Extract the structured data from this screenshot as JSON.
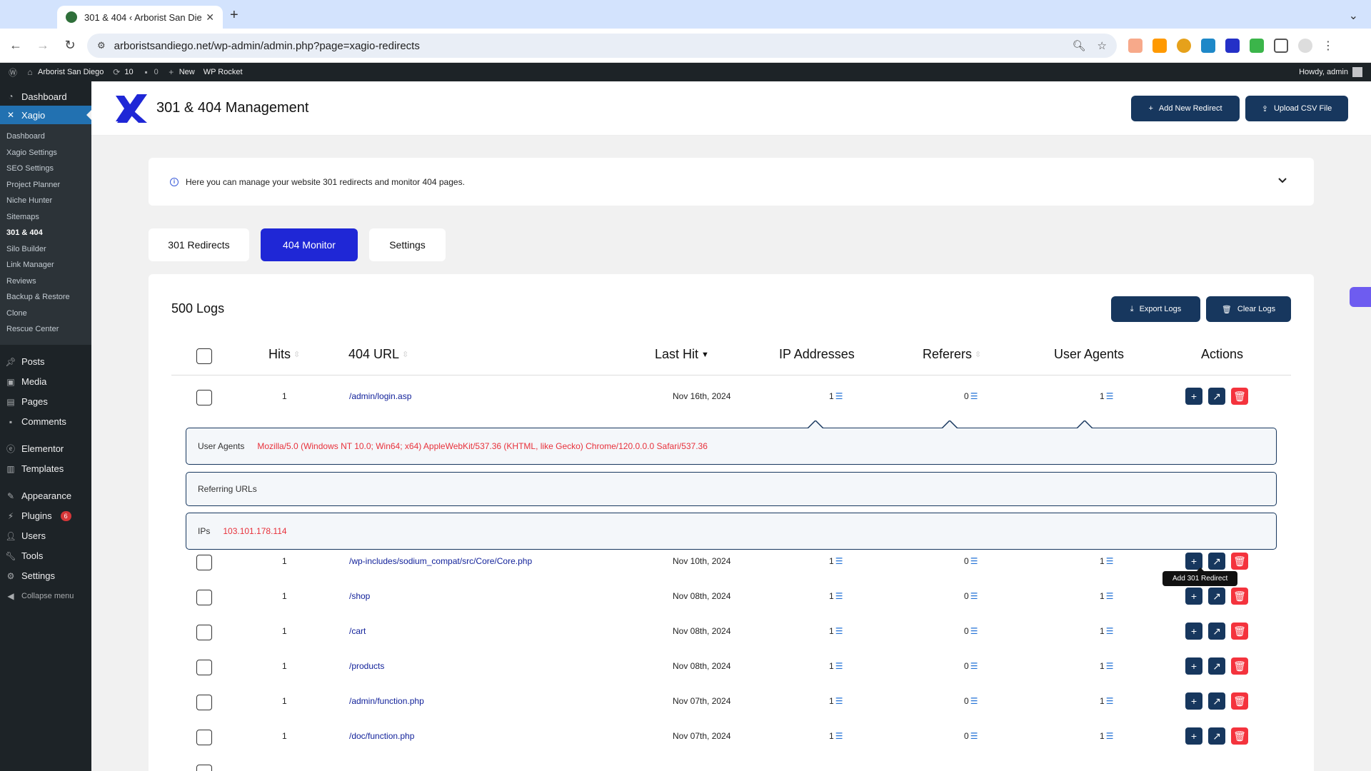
{
  "browser": {
    "tab_title": "301 & 404 ‹ Arborist San Die…",
    "url": "arboristsandiego.net/wp-admin/admin.php?page=xagio-redirects"
  },
  "adminbar": {
    "site": "Arborist San Diego",
    "updates": "10",
    "comments": "0",
    "new": "New",
    "rocket": "WP Rocket",
    "howdy": "Howdy, admin"
  },
  "sidebar": {
    "dashboard": "Dashboard",
    "xagio": "Xagio",
    "sub": [
      "Dashboard",
      "Xagio Settings",
      "SEO Settings",
      "Project Planner",
      "Niche Hunter",
      "Sitemaps",
      "301 & 404",
      "Silo Builder",
      "Link Manager",
      "Reviews",
      "Backup & Restore",
      "Clone",
      "Rescue Center"
    ],
    "posts": "Posts",
    "media": "Media",
    "pages": "Pages",
    "comments": "Comments",
    "elementor": "Elementor",
    "templates": "Templates",
    "appearance": "Appearance",
    "plugins": "Plugins",
    "plugins_badge": "6",
    "users": "Users",
    "tools": "Tools",
    "settings": "Settings",
    "collapse": "Collapse menu"
  },
  "header": {
    "title": "301 & 404 Management",
    "add_btn": "Add New Redirect",
    "upload_btn": "Upload CSV File"
  },
  "info": "Here you can manage your website 301 redirects and monitor 404 pages.",
  "tabs": [
    "301 Redirects",
    "404 Monitor",
    "Settings"
  ],
  "logs": {
    "title": "500 Logs",
    "export": "Export Logs",
    "clear": "Clear Logs",
    "columns": {
      "hits": "Hits",
      "url": "404 URL",
      "last": "Last Hit",
      "ip": "IP Addresses",
      "ref": "Referers",
      "ua": "User Agents",
      "actions": "Actions"
    },
    "first_row": {
      "hits": "1",
      "url": "/admin/login.asp",
      "date": "Nov 16th, 2024",
      "ip": "1",
      "ref": "0",
      "ua": "1"
    },
    "expanded": {
      "ua_label": "User Agents",
      "ua_value": "Mozilla/5.0 (Windows NT 10.0; Win64; x64) AppleWebKit/537.36 (KHTML, like Gecko) Chrome/120.0.0.0 Safari/537.36",
      "ref_label": "Referring URLs",
      "ip_label": "IPs",
      "ip_value": "103.101.178.114"
    },
    "rows": [
      {
        "hits": "1",
        "url": "/wp-includes/sodium_compat/src/Core/Core.php",
        "date": "Nov 10th, 2024",
        "ip": "1",
        "ref": "0",
        "ua": "1"
      },
      {
        "hits": "1",
        "url": "/shop",
        "date": "Nov 08th, 2024",
        "ip": "1",
        "ref": "0",
        "ua": "1"
      },
      {
        "hits": "1",
        "url": "/cart",
        "date": "Nov 08th, 2024",
        "ip": "1",
        "ref": "0",
        "ua": "1"
      },
      {
        "hits": "1",
        "url": "/products",
        "date": "Nov 08th, 2024",
        "ip": "1",
        "ref": "0",
        "ua": "1"
      },
      {
        "hits": "1",
        "url": "/admin/function.php",
        "date": "Nov 07th, 2024",
        "ip": "1",
        "ref": "0",
        "ua": "1"
      },
      {
        "hits": "1",
        "url": "/doc/function.php",
        "date": "Nov 07th, 2024",
        "ip": "1",
        "ref": "0",
        "ua": "1"
      }
    ],
    "tooltip": "Add 301 Redirect"
  },
  "colors": {
    "accent": "#1f27d6",
    "dark": "#17375e",
    "danger": "#f4333d",
    "wp_blue": "#2271b1"
  }
}
